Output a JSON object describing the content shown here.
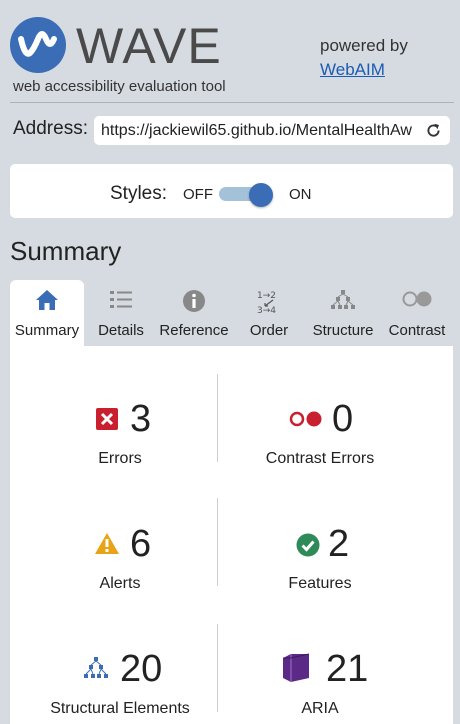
{
  "brand": {
    "name": "WAVE",
    "tagline": "web accessibility evaluation tool",
    "powered_by": "powered by",
    "webaim_link": "WebAIM",
    "logo_color": "#3a6db5"
  },
  "address": {
    "label": "Address:",
    "value": "https://jackiewil65.github.io/MentalHealthAw",
    "refresh_icon": "refresh-icon"
  },
  "styles": {
    "label": "Styles:",
    "off": "OFF",
    "on": "ON",
    "state": "on"
  },
  "summary_heading": "Summary",
  "tabs": [
    {
      "label": "Summary",
      "icon": "home-icon",
      "active": true
    },
    {
      "label": "Details",
      "icon": "list-icon",
      "active": false
    },
    {
      "label": "Reference",
      "icon": "info-icon",
      "active": false
    },
    {
      "label": "Order",
      "icon": "order-icon",
      "active": false
    },
    {
      "label": "Structure",
      "icon": "structure-icon",
      "active": false
    },
    {
      "label": "Contrast",
      "icon": "contrast-icon",
      "active": false
    }
  ],
  "stats": {
    "errors": {
      "count": "3",
      "label": "Errors",
      "color": "#c8202f"
    },
    "contrast_errors": {
      "count": "0",
      "label": "Contrast Errors",
      "color": "#c8202f"
    },
    "alerts": {
      "count": "6",
      "label": "Alerts",
      "color": "#e8a317"
    },
    "features": {
      "count": "2",
      "label": "Features",
      "color": "#2e8a57"
    },
    "structural": {
      "count": "20",
      "label": "Structural Elements",
      "color": "#3a6db5"
    },
    "aria": {
      "count": "21",
      "label": "ARIA",
      "color": "#5b2a86"
    }
  }
}
